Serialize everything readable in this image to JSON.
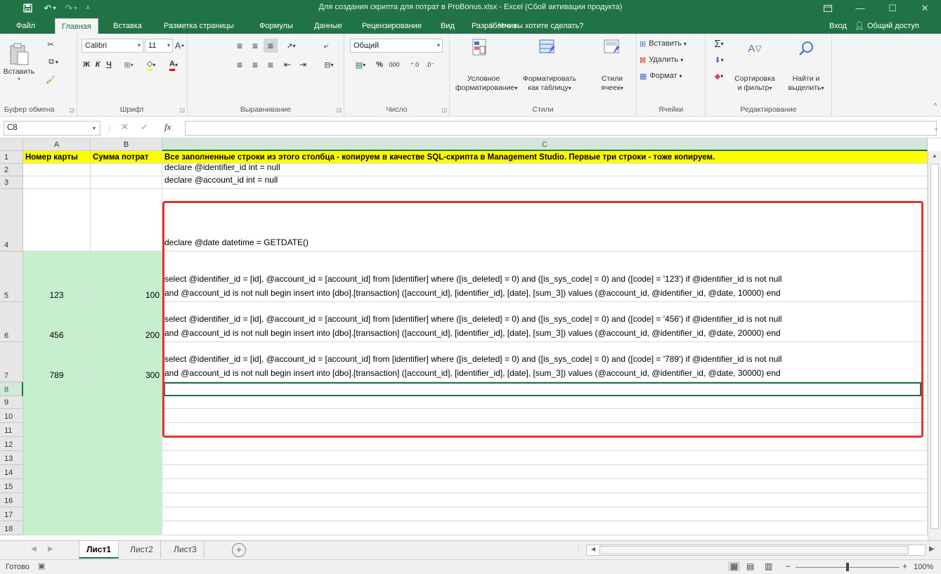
{
  "window": {
    "title": "Для создания скрипта для потрат в ProBonus.xlsx - Excel (Сбой активации продукта)"
  },
  "tabs": [
    "Файл",
    "Главная",
    "Вставка",
    "Разметка страницы",
    "Формулы",
    "Данные",
    "Рецензирование",
    "Вид",
    "Разработчик"
  ],
  "active_tab": "Главная",
  "tell_me": "Что вы хотите сделать?",
  "signin": "Вход",
  "share": "Общий доступ",
  "ribbon": {
    "clipboard": {
      "paste": "Вставить",
      "label": "Буфер обмена"
    },
    "font": {
      "name": "Calibri",
      "size": "11",
      "label": "Шрифт",
      "bold": "Ж",
      "italic": "К",
      "underline": "Ч"
    },
    "alignment": {
      "label": "Выравнивание"
    },
    "number": {
      "format": "Общий",
      "label": "Число",
      "percent": "%",
      "thousands": "000"
    },
    "styles": {
      "conditional": "Условное",
      "conditional2": "форматирование",
      "as_table": "Форматировать",
      "as_table2": "как таблицу",
      "cell_styles": "Стили",
      "cell_styles2": "ячеек",
      "label": "Стили"
    },
    "cells": {
      "insert": "Вставить",
      "delete": "Удалить",
      "format": "Формат",
      "label": "Ячейки"
    },
    "editing": {
      "sort": "Сортировка",
      "sort2": "и фильтр",
      "find": "Найти и",
      "find2": "выделить",
      "label": "Редактирование"
    }
  },
  "formula_bar": {
    "name_box": "C8",
    "fx": "fx",
    "value": ""
  },
  "columns": [
    "A",
    "B",
    "C"
  ],
  "rows": [
    "1",
    "2",
    "3",
    "4",
    "5",
    "6",
    "7",
    "8",
    "9",
    "10",
    "11",
    "12",
    "13",
    "14",
    "15",
    "16",
    "17",
    "18"
  ],
  "cells": {
    "A1": "Номер карты",
    "B1": "Сумма потрат",
    "C1": "Все заполненные строки из этого столбца - копируем в качестве  SQL-скрипта в Management Studio. Первые три строки - тоже копируем.",
    "C2": "declare @identifier_id int = null",
    "C3": "declare @account_id int = null",
    "C4": "declare @date datetime = GETDATE()",
    "A5": "123",
    "B5": "100",
    "C5a": "select @identifier_id = [id], @account_id = [account_id] from [identifier] where ([is_deleted] = 0) and ([is_sys_code] = 0) and ([code] = '123') if @identifier_id is not null",
    "C5b": "and @account_id is not null begin  insert into [dbo].[transaction] ([account_id], [identifier_id], [date], [sum_3]) values (@account_id, @identifier_id, @date, 10000) end",
    "A6": "456",
    "B6": "200",
    "C6a": "select @identifier_id = [id], @account_id = [account_id] from [identifier] where ([is_deleted] = 0) and ([is_sys_code] = 0) and ([code] = '456') if @identifier_id is not null",
    "C6b": "and @account_id is not null begin  insert into [dbo].[transaction] ([account_id], [identifier_id], [date], [sum_3]) values (@account_id, @identifier_id, @date, 20000) end",
    "A7": "789",
    "B7": "300",
    "C7a": "select @identifier_id = [id], @account_id = [account_id] from [identifier] where ([is_deleted] = 0) and ([is_sys_code] = 0) and ([code] = '789') if @identifier_id is not null",
    "C7b": "and @account_id is not null begin  insert into [dbo].[transaction] ([account_id], [identifier_id], [date], [sum_3]) values (@account_id, @identifier_id, @date, 30000) end"
  },
  "sheets": [
    "Лист1",
    "Лист2",
    "Лист3"
  ],
  "active_sheet": "Лист1",
  "status": {
    "ready": "Готово",
    "zoom": "100%"
  },
  "colors": {
    "accent": "#217346",
    "header_fill": "#ffff00",
    "green_fill": "#c6efce",
    "highlight_border": "#e3332e"
  }
}
